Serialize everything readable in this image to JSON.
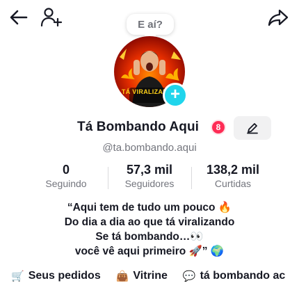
{
  "header": {
    "back_icon": "arrow-left-icon",
    "add_user_icon": "add-person-icon",
    "share_icon": "share-arrow-icon",
    "bubble_text": "E aí?"
  },
  "avatar": {
    "caption": "TÁ VIRALIZANDO",
    "add_icon": "+"
  },
  "profile": {
    "name": "Tá Bombando Aqui",
    "badge_count": "8",
    "handle": "@ta.bombando.aqui",
    "edit_icon": "pencil-icon"
  },
  "stats": [
    {
      "value": "0",
      "label": "Seguindo"
    },
    {
      "value": "57,3 mil",
      "label": "Seguidores"
    },
    {
      "value": "138,2 mil",
      "label": "Curtidas"
    }
  ],
  "bio": {
    "line1": "“Aqui tem de tudo um pouco 🔥",
    "line2": "Do dia a dia ao que tá viralizando",
    "line3": "Se tá bombando…👀",
    "line4": "você vê aqui primeiro 🚀” 🌍"
  },
  "links": [
    {
      "icon": "cart-icon",
      "glyph": "🛒",
      "label": "Seus pedidos"
    },
    {
      "icon": "shopping-bag-icon",
      "glyph": "👜",
      "label": "Vitrine"
    },
    {
      "icon": "chat-icon",
      "glyph": "💬",
      "label": "tá bombando ac"
    }
  ],
  "colors": {
    "accent": "#fe2c55",
    "plus": "#20d5ec",
    "muted_text": "#73757d"
  }
}
